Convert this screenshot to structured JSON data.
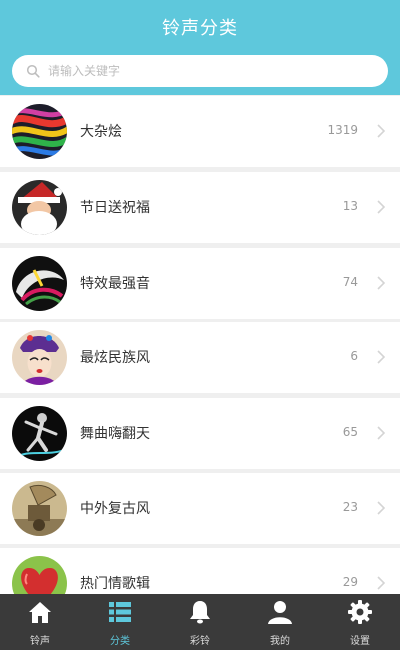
{
  "header": {
    "title": "铃声分类"
  },
  "search": {
    "placeholder": "请输入关键字"
  },
  "categories": [
    {
      "label": "大杂烩",
      "count": "1319"
    },
    {
      "label": "节日送祝福",
      "count": "13"
    },
    {
      "label": "特效最强音",
      "count": "74"
    },
    {
      "label": "最炫民族风",
      "count": "6"
    },
    {
      "label": "舞曲嗨翻天",
      "count": "65"
    },
    {
      "label": "中外复古风",
      "count": "23"
    },
    {
      "label": "热门情歌辑",
      "count": "29"
    }
  ],
  "tabs": [
    {
      "label": "铃声",
      "icon": "home-icon"
    },
    {
      "label": "分类",
      "icon": "category-grid-icon",
      "active": true
    },
    {
      "label": "彩铃",
      "icon": "bell-icon"
    },
    {
      "label": "我的",
      "icon": "user-icon"
    },
    {
      "label": "设置",
      "icon": "gear-icon"
    }
  ],
  "colors": {
    "accent": "#5ec8dc",
    "tabbar": "#3a3a3a",
    "background": "#efefef"
  }
}
